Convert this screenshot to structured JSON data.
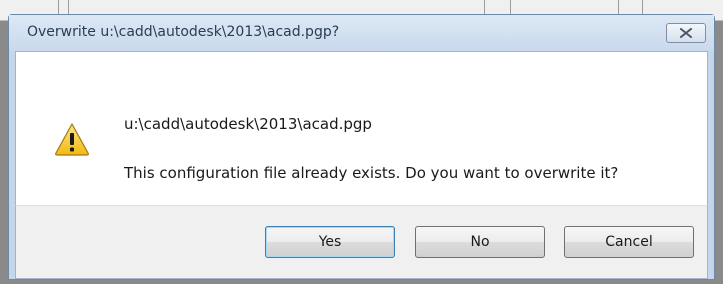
{
  "dialog": {
    "title": "Overwrite u:\\cadd\\autodesk\\2013\\acad.pgp?",
    "message_path": "u:\\cadd\\autodesk\\2013\\acad.pgp",
    "message_body": "This configuration file already exists. Do you want to overwrite it?",
    "icon": "warning-icon"
  },
  "buttons": {
    "yes_label": "Yes",
    "no_label": "No",
    "cancel_label": "Cancel"
  },
  "colors": {
    "warning_yellow": "#f7c928",
    "frame_blue": "#c5d6ea"
  }
}
